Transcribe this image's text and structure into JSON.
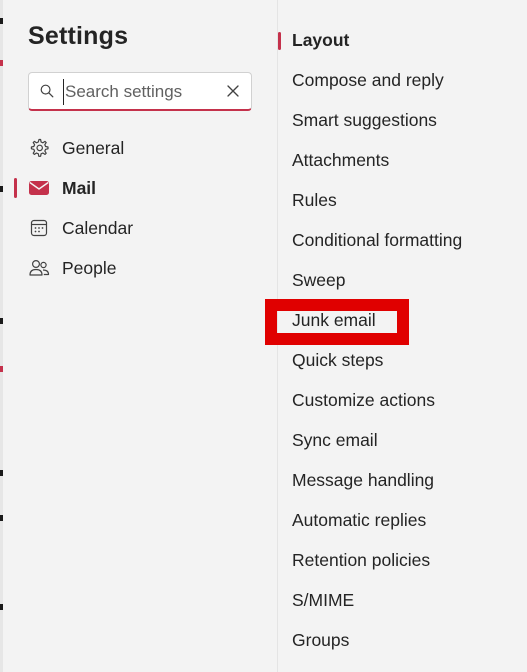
{
  "header": {
    "title": "Settings"
  },
  "search": {
    "placeholder": "Search settings"
  },
  "nav": {
    "items": [
      {
        "label": "General",
        "icon": "gear-icon",
        "selected": false
      },
      {
        "label": "Mail",
        "icon": "mail-icon",
        "selected": true
      },
      {
        "label": "Calendar",
        "icon": "calendar-icon",
        "selected": false
      },
      {
        "label": "People",
        "icon": "people-icon",
        "selected": false
      }
    ]
  },
  "mail_settings": {
    "items": [
      {
        "label": "Layout",
        "selected": true
      },
      {
        "label": "Compose and reply",
        "selected": false
      },
      {
        "label": "Smart suggestions",
        "selected": false
      },
      {
        "label": "Attachments",
        "selected": false
      },
      {
        "label": "Rules",
        "selected": false
      },
      {
        "label": "Conditional formatting",
        "selected": false
      },
      {
        "label": "Sweep",
        "selected": false
      },
      {
        "label": "Junk email",
        "selected": false
      },
      {
        "label": "Quick steps",
        "selected": false
      },
      {
        "label": "Customize actions",
        "selected": false
      },
      {
        "label": "Sync email",
        "selected": false
      },
      {
        "label": "Message handling",
        "selected": false
      },
      {
        "label": "Automatic replies",
        "selected": false
      },
      {
        "label": "Retention policies",
        "selected": false
      },
      {
        "label": "S/MIME",
        "selected": false
      },
      {
        "label": "Groups",
        "selected": false
      }
    ]
  },
  "colors": {
    "accent": "#c4314b",
    "highlight": "#e00000",
    "background": "#f3f3f3"
  }
}
